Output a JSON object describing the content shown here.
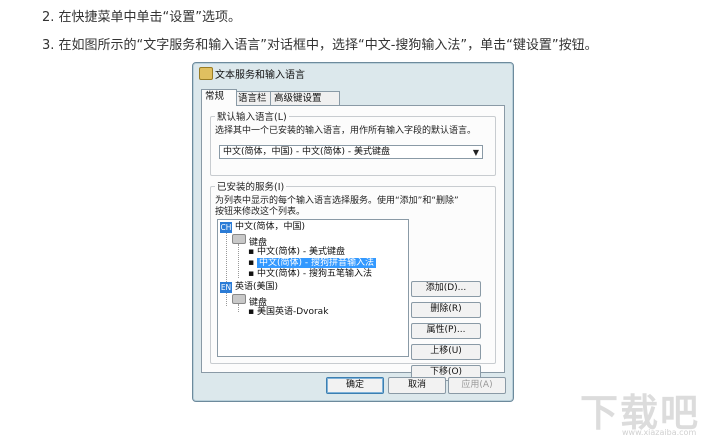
{
  "steps": [
    "2. 在快捷菜单中单击“设置”选项。",
    "3. 在如图所示的“文字服务和输入语言”对话框中，选择“中文-搜狗输入法”，单击“键设置”按钮。"
  ],
  "dialog": {
    "title": "文本服务和输入语言",
    "tabs": [
      "常规",
      "语言栏",
      "高级键设置"
    ],
    "default_group": {
      "legend": "默认输入语言(L)",
      "desc": "选择其中一个已安装的输入语言，用作所有输入字段的默认语言。",
      "selected": "中文(简体，中国) - 中文(简体) - 美式键盘"
    },
    "installed_group": {
      "legend": "已安装的服务(I)",
      "desc1": "为列表中显示的每个输入语言选择服务。使用“添加”和“删除”",
      "desc2": "按钮来修改这个列表。",
      "tree": {
        "zh_badge": "CH",
        "zh_lang": "中文(简体，中国)",
        "zh_keyboard": "键盘",
        "zh_items": [
          "中文(简体) - 美式键盘",
          "中文(简体) - 搜狗拼音输入法",
          "中文(简体) - 搜狗五笔输入法"
        ],
        "en_badge": "EN",
        "en_lang": "英语(美国)",
        "en_keyboard": "键盘",
        "en_items": [
          "美国英语-Dvorak"
        ]
      },
      "buttons": {
        "add": "添加(D)...",
        "remove": "删除(R)",
        "properties": "属性(P)...",
        "up": "上移(U)",
        "down": "下移(O)"
      }
    },
    "footer": {
      "ok": "确定",
      "cancel": "取消",
      "apply": "应用(A)"
    }
  },
  "watermark": {
    "main": "下载吧",
    "sub": "www.xiazaiba.com"
  }
}
